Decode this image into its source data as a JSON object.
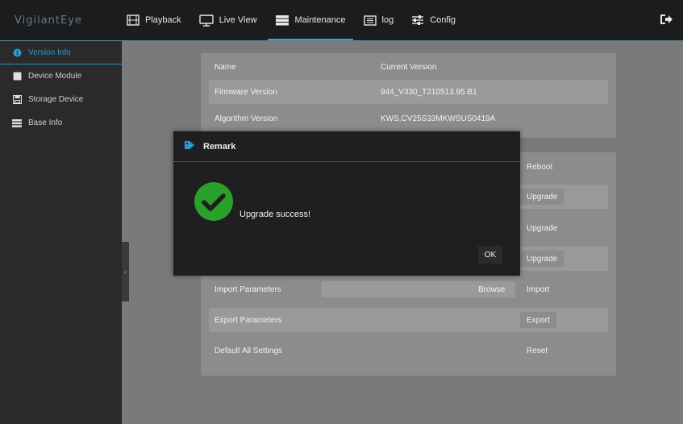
{
  "app": {
    "logo": "VigilantEye"
  },
  "nav": {
    "items": [
      {
        "label": "Playback",
        "icon": "film-icon"
      },
      {
        "label": "Live View",
        "icon": "monitor-icon"
      },
      {
        "label": "Maintenance",
        "icon": "server-icon",
        "active": true
      },
      {
        "label": "log",
        "icon": "list-icon"
      },
      {
        "label": "Config",
        "icon": "sliders-icon"
      }
    ]
  },
  "sidebar": {
    "items": [
      {
        "label": "Version Info",
        "icon": "info-icon",
        "active": true
      },
      {
        "label": "Device Module",
        "icon": "square-icon"
      },
      {
        "label": "Storage Device",
        "icon": "floppy-icon"
      },
      {
        "label": "Base Info",
        "icon": "list-icon"
      }
    ]
  },
  "version_table": {
    "header": {
      "name": "Name",
      "value": "Current Version"
    },
    "rows": [
      {
        "name": "Firmware Version",
        "value": "944_V330_T210513.95.B1"
      },
      {
        "name": "Algorithm Version",
        "value": "KWS.CV25S33MKWSUS0419A"
      }
    ]
  },
  "actions": {
    "reboot": "Reboot",
    "upgrade": "Upgrade",
    "import_label": "Import Parameters",
    "browse": "Browse",
    "import": "Import",
    "export_label": "Export Parameters",
    "export": "Export",
    "default_label": "Default All Settings",
    "reset": "Reset"
  },
  "dialog": {
    "title": "Remark",
    "message": "Upgrade success!",
    "ok": "OK"
  },
  "colors": {
    "accent": "#36a6c9",
    "success": "#2aa12a",
    "dialog_bg": "#1f1f21"
  }
}
